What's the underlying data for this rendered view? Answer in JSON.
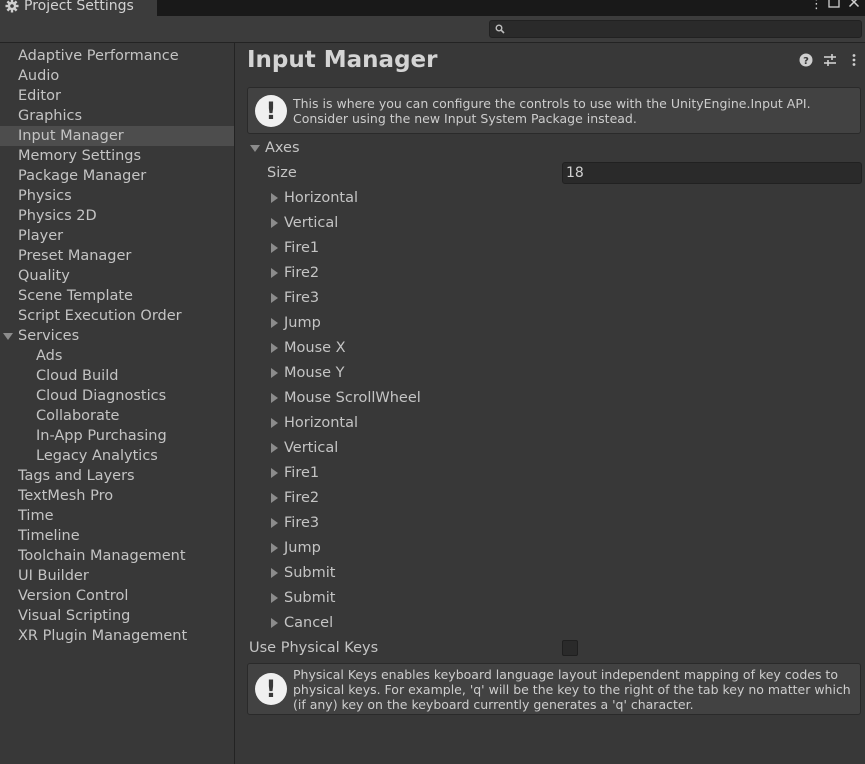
{
  "window": {
    "tab_title": "Project Settings",
    "search": {
      "placeholder": ""
    }
  },
  "sidebar": {
    "items": [
      {
        "label": "Adaptive Performance"
      },
      {
        "label": "Audio"
      },
      {
        "label": "Editor"
      },
      {
        "label": "Graphics"
      },
      {
        "label": "Input Manager",
        "selected": true
      },
      {
        "label": "Memory Settings"
      },
      {
        "label": "Package Manager"
      },
      {
        "label": "Physics"
      },
      {
        "label": "Physics 2D"
      },
      {
        "label": "Player"
      },
      {
        "label": "Preset Manager"
      },
      {
        "label": "Quality"
      },
      {
        "label": "Scene Template"
      },
      {
        "label": "Script Execution Order"
      },
      {
        "label": "Services",
        "expanded": true
      },
      {
        "label": "Ads",
        "child": true
      },
      {
        "label": "Cloud Build",
        "child": true
      },
      {
        "label": "Cloud Diagnostics",
        "child": true
      },
      {
        "label": "Collaborate",
        "child": true
      },
      {
        "label": "In-App Purchasing",
        "child": true
      },
      {
        "label": "Legacy Analytics",
        "child": true
      },
      {
        "label": "Tags and Layers"
      },
      {
        "label": "TextMesh Pro"
      },
      {
        "label": "Time"
      },
      {
        "label": "Timeline"
      },
      {
        "label": "Toolchain Management"
      },
      {
        "label": "UI Builder"
      },
      {
        "label": "Version Control"
      },
      {
        "label": "Visual Scripting"
      },
      {
        "label": "XR Plugin Management"
      }
    ]
  },
  "main": {
    "title": "Input Manager",
    "header_icons": [
      "help-icon",
      "preset-sliders-icon",
      "more-options-icon"
    ],
    "info_box": {
      "line1": "This is where you can configure the controls to use with the UnityEngine.Input API.",
      "line2": "Consider using the new Input System Package instead."
    },
    "axes": {
      "label": "Axes",
      "size_label": "Size",
      "size_value": "18",
      "items": [
        "Horizontal",
        "Vertical",
        "Fire1",
        "Fire2",
        "Fire3",
        "Jump",
        "Mouse X",
        "Mouse Y",
        "Mouse ScrollWheel",
        "Horizontal",
        "Vertical",
        "Fire1",
        "Fire2",
        "Fire3",
        "Jump",
        "Submit",
        "Submit",
        "Cancel"
      ]
    },
    "physical_keys": {
      "label": "Use Physical Keys",
      "checked": false,
      "help_line1": "Physical Keys enables keyboard language layout independent mapping of key codes to",
      "help_line2": "physical keys. For example, 'q' will be the key to the right of the tab key no matter which",
      "help_line3": "(if any) key on the keyboard currently generates a 'q' character."
    }
  },
  "colors": {
    "background": "#383838",
    "selected_row": "#4d4d4d",
    "text": "#c4c4c4",
    "field_bg": "#2a2a2a"
  }
}
